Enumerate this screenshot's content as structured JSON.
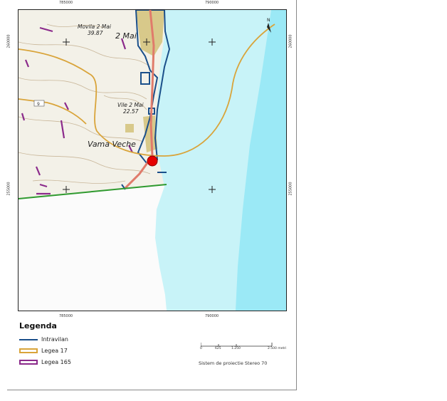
{
  "map": {
    "places": [
      {
        "name": "Movila 2 Mai",
        "value": "39.87"
      },
      {
        "name": "2 Mai",
        "value": ""
      },
      {
        "name": "Vile 2 Mai",
        "value": "22.57"
      },
      {
        "name": "Vama Veche",
        "value": ""
      }
    ],
    "road_label": "9",
    "north_label": "N",
    "x_ticks": [
      "785000",
      "790000"
    ],
    "y_ticks": [
      "260000",
      "255000"
    ]
  },
  "legend": {
    "title": "Legenda",
    "items": [
      {
        "label": "Intravilan",
        "color": "#1a4f8a",
        "style": "line"
      },
      {
        "label": "Legea 17",
        "color": "#d9a43a",
        "style": "box"
      },
      {
        "label": "Legea 165",
        "color": "#8b2a8b",
        "style": "box"
      }
    ]
  },
  "scale": {
    "labels": [
      "0",
      "625",
      "1.250",
      "2.500 metri"
    ]
  },
  "projection": "Sistem de proiectie Stereo 70",
  "colors": {
    "sea": "#c8f3f8",
    "sea_deep": "#9be9f6",
    "land": "#f3f1e8",
    "contour": "#c9b79a",
    "road": "#e07b6b",
    "urban": "#d8c98a",
    "legea17": "#d9a43a",
    "legea165": "#8b2a8b",
    "intravilan": "#1a4f8a",
    "border": "#2f9a2f",
    "marker": "#e60000"
  }
}
